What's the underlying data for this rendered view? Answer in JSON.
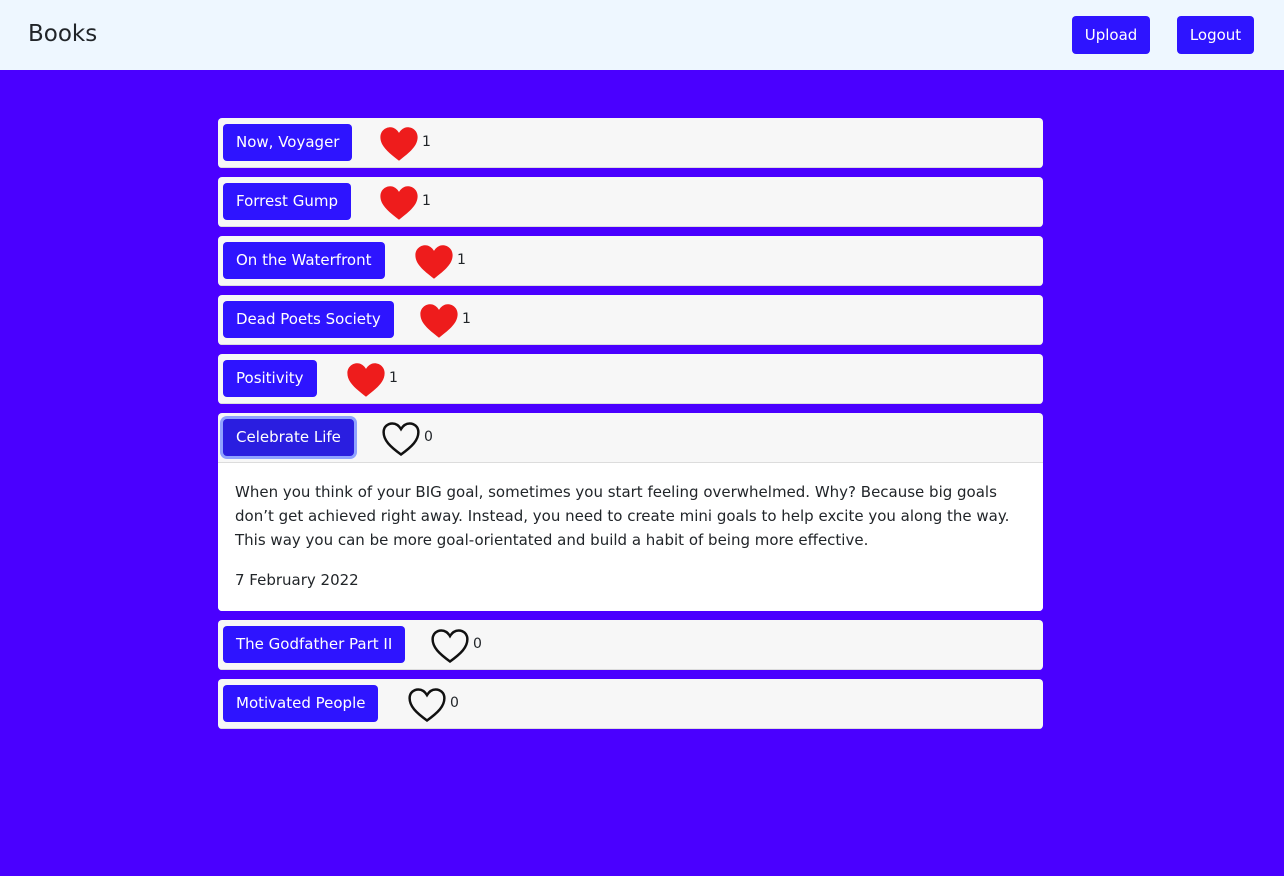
{
  "nav": {
    "brand": "Books",
    "upload_label": "Upload",
    "logout_label": "Logout"
  },
  "colors": {
    "background": "#4a00ff",
    "navbar": "#eef7ff",
    "button": "#2e14ff",
    "heart_filled": "#ee1c1c"
  },
  "books": [
    {
      "title": "Now, Voyager",
      "likes": "1",
      "liked": true
    },
    {
      "title": "Forrest Gump",
      "likes": "1",
      "liked": true
    },
    {
      "title": "On the Waterfront",
      "likes": "1",
      "liked": true
    },
    {
      "title": "Dead Poets Society",
      "likes": "1",
      "liked": true
    },
    {
      "title": "Positivity",
      "likes": "1",
      "liked": true
    },
    {
      "title": "Celebrate Life",
      "likes": "0",
      "liked": false,
      "expanded": true,
      "description": "When you think of your BIG goal, sometimes you start feeling overwhelmed. Why? Because big goals don’t get achieved right away. Instead, you need to create mini goals to help excite you along the way. This way you can be more goal-orientated and build a habit of being more effective.",
      "date": "7 February 2022"
    },
    {
      "title": "The Godfather Part II",
      "likes": "0",
      "liked": false
    },
    {
      "title": "Motivated People",
      "likes": "0",
      "liked": false
    }
  ]
}
